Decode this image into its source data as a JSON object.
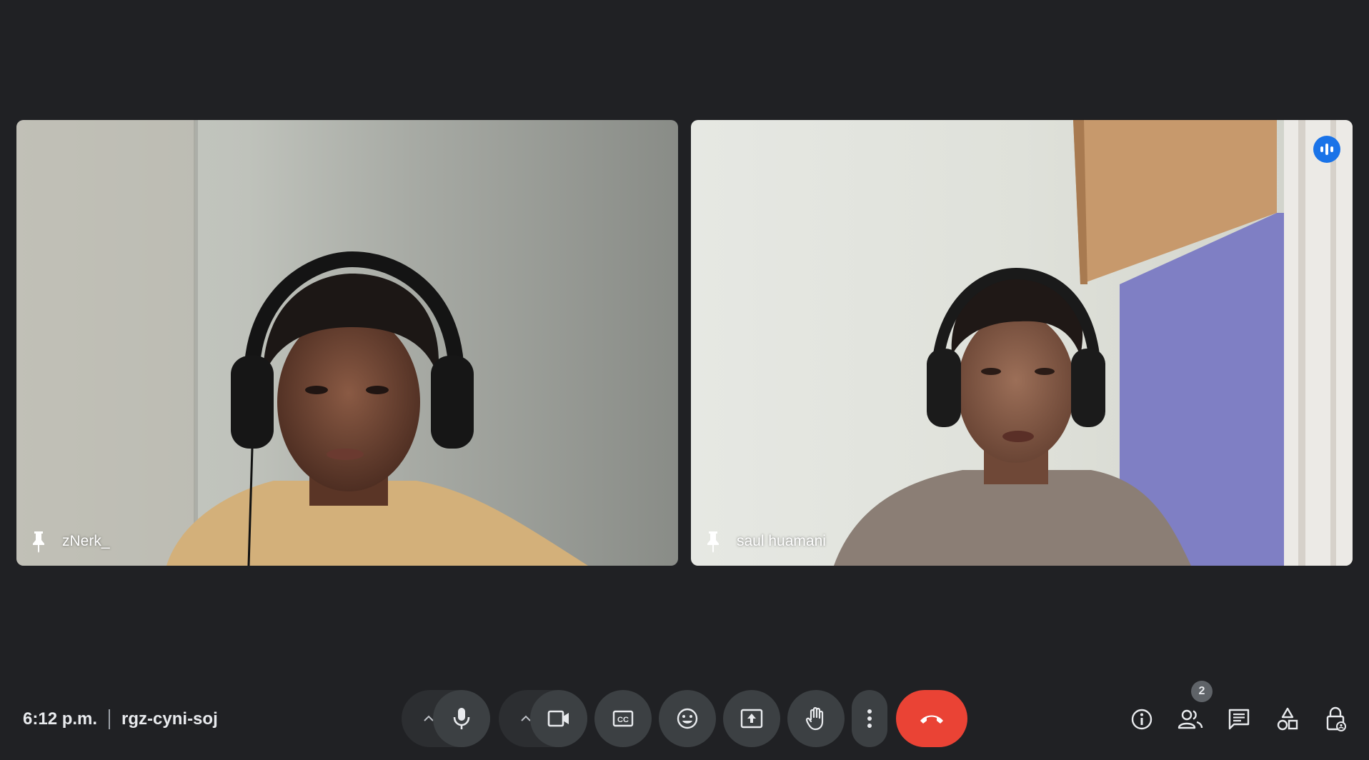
{
  "meeting": {
    "time": "6:12 p.m.",
    "code": "rgz-cyni-soj"
  },
  "participants": [
    {
      "name": "zNerk_",
      "pinned_icon": "pin-icon",
      "speaking": false
    },
    {
      "name": "saul huamani",
      "pinned_icon": "pin-icon",
      "speaking": true
    }
  ],
  "toolbar": {
    "buttons": [
      "mic-options-chevron",
      "microphone-icon",
      "camera-options-chevron",
      "camera-icon",
      "captions-icon",
      "emoji-icon",
      "present-screen-icon",
      "raise-hand-icon",
      "more-options-icon",
      "end-call-icon"
    ]
  },
  "right_controls": {
    "people_count": "2",
    "icons": [
      "info-icon",
      "people-icon",
      "chat-icon",
      "activities-icon",
      "host-controls-icon"
    ]
  },
  "colors": {
    "background": "#202124",
    "button": "#3c4043",
    "end_call": "#ea4335",
    "speaking_accent": "#1a73e8"
  }
}
